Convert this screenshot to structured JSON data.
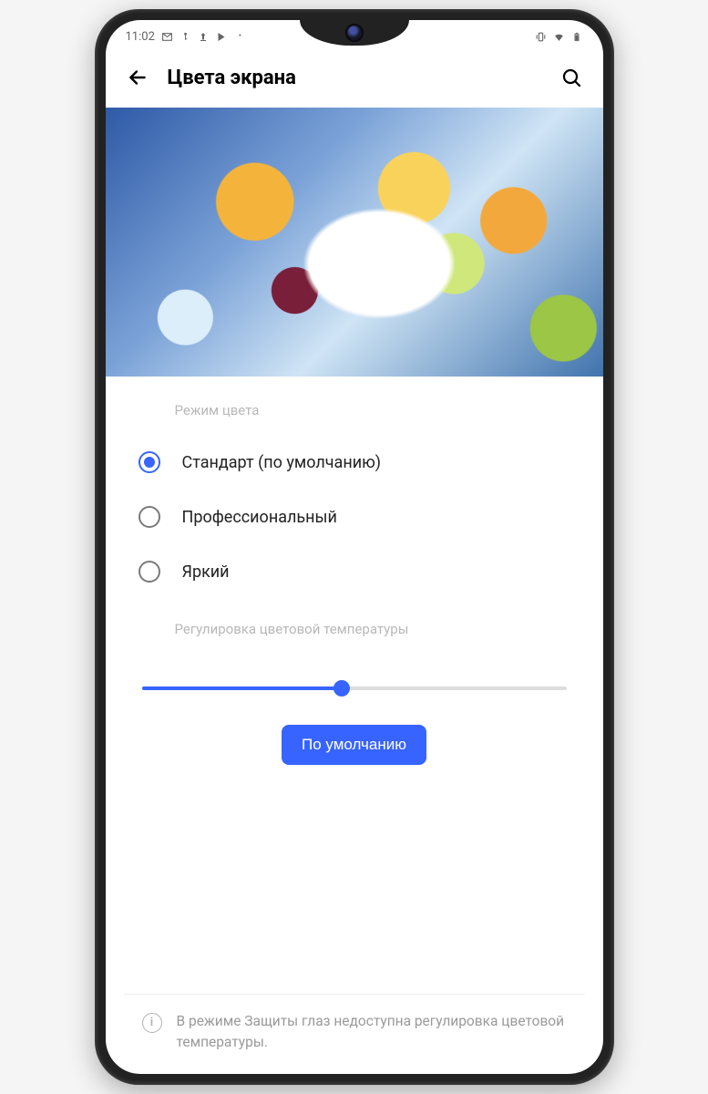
{
  "status": {
    "time": "11:02"
  },
  "header": {
    "title": "Цвета экрана"
  },
  "mode_section": {
    "label": "Режим цвета",
    "options": [
      {
        "label": "Стандарт (по умолчанию)",
        "selected": true
      },
      {
        "label": "Профессиональный",
        "selected": false
      },
      {
        "label": "Яркий",
        "selected": false
      }
    ]
  },
  "temperature": {
    "label": "Регулировка цветовой температуры",
    "value_percent": 47,
    "default_button": "По умолчанию"
  },
  "footer": {
    "note": "В режиме Защиты глаз недоступна регулировка цветовой температуры."
  },
  "colors": {
    "accent": "#3764ff"
  }
}
